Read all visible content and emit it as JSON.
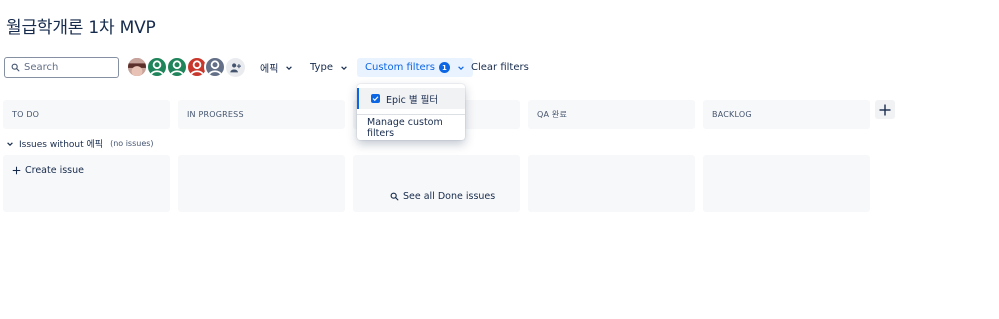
{
  "page": {
    "title": "월급학개론 1차 MVP"
  },
  "toolbar": {
    "search_placeholder": "Search",
    "epic_filter_label": "에픽",
    "type_filter_label": "Type",
    "custom_filters_label": "Custom filters",
    "custom_filters_count": "1",
    "clear_filters_label": "Clear filters"
  },
  "avatars": [
    {
      "kind": "photo",
      "color": "#8b5a4a"
    },
    {
      "kind": "user",
      "color": "#1f845a"
    },
    {
      "kind": "user",
      "color": "#1f845a"
    },
    {
      "kind": "user",
      "color": "#c9372c"
    },
    {
      "kind": "user",
      "color": "#626f86"
    }
  ],
  "columns": [
    {
      "label": "TO DO"
    },
    {
      "label": "IN PROGRESS"
    },
    {
      "label": ""
    },
    {
      "label": "QA 완료"
    },
    {
      "label": "BACKLOG"
    }
  ],
  "swimlane": {
    "label": "Issues without 에픽",
    "count_label": "(no issues)"
  },
  "board": {
    "create_issue_label": "Create issue",
    "see_done_label": "See all Done issues"
  },
  "dropdown": {
    "items": [
      {
        "label": "Epic 별 필터",
        "checked": true
      }
    ],
    "manage_label": "Manage custom filters"
  },
  "colors": {
    "accent": "#0c66e4",
    "column_bg": "#f7f8f9",
    "text": "#172b4d"
  }
}
